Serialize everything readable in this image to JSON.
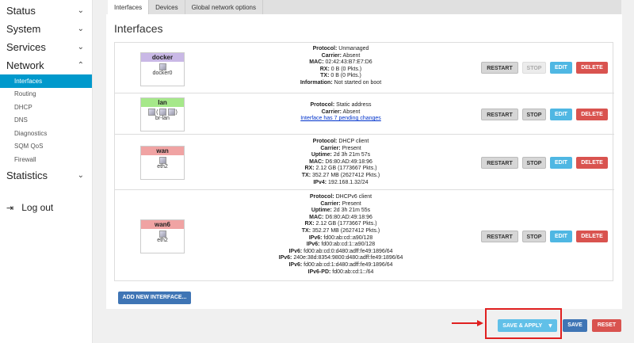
{
  "sidebar": {
    "status": "Status",
    "system": "System",
    "services": "Services",
    "network": "Network",
    "network_items": [
      "Interfaces",
      "Routing",
      "DHCP",
      "DNS",
      "Diagnostics",
      "SQM QoS",
      "Firewall"
    ],
    "statistics": "Statistics",
    "logout": "Log out"
  },
  "tabs": [
    "Interfaces",
    "Devices",
    "Global network options"
  ],
  "page_title": "Interfaces",
  "interfaces": [
    {
      "name": "docker",
      "color": "#c9b8e6",
      "device": "docker0",
      "info": [
        [
          "Protocol:",
          "Unmanaged"
        ],
        [
          "Carrier:",
          "Absent"
        ],
        [
          "MAC:",
          "02:42:43:B7:E7:D6"
        ],
        [
          "RX:",
          "0 B (0 Pkts.)"
        ],
        [
          "TX:",
          "0 B (0 Pkts.)"
        ],
        [
          "Information:",
          "Not started on boot"
        ]
      ],
      "stop_disabled": true
    },
    {
      "name": "lan",
      "color": "#a6e88a",
      "device": "br-lan",
      "info": [
        [
          "Protocol:",
          "Static address"
        ],
        [
          "Carrier:",
          "Absent"
        ]
      ],
      "link": "Interface has 7 pending changes",
      "stop_disabled": false
    },
    {
      "name": "wan",
      "color": "#f0a3a3",
      "device": "eth2",
      "info": [
        [
          "Protocol:",
          "DHCP client"
        ],
        [
          "Carrier:",
          "Present"
        ],
        [
          "Uptime:",
          "2d 3h 21m 57s"
        ],
        [
          "MAC:",
          "D6:80:AD:49:18:96"
        ],
        [
          "RX:",
          "2.12 GB (1773667 Pkts.)"
        ],
        [
          "TX:",
          "352.27 MB (2627412 Pkts.)"
        ],
        [
          "IPv4:",
          "192.168.1.32/24"
        ]
      ],
      "stop_disabled": false
    },
    {
      "name": "wan6",
      "color": "#f0a3a3",
      "device": "eth2",
      "info": [
        [
          "Protocol:",
          "DHCPv6 client"
        ],
        [
          "Carrier:",
          "Present"
        ],
        [
          "Uptime:",
          "2d 3h 21m 55s"
        ],
        [
          "MAC:",
          "D6:80:AD:49:18:96"
        ],
        [
          "RX:",
          "2.12 GB (1773667 Pkts.)"
        ],
        [
          "TX:",
          "352.27 MB (2627412 Pkts.)"
        ],
        [
          "IPv6:",
          "fd00:ab:cd::a90/128"
        ],
        [
          "IPv6:",
          "fd00:ab:cd:1::a90/128"
        ],
        [
          "IPv6:",
          "fd00:ab:cd:0:d480:adff:fe49:1896/64"
        ],
        [
          "IPv6:",
          "240e:38d:8354:9800:d480:adff:fe49:1896/64"
        ],
        [
          "IPv6:",
          "fd00:ab:cd:1:d480:adff:fe49:1896/64"
        ],
        [
          "IPv6-PD:",
          "fd00:ab:cd:1::/64"
        ]
      ],
      "stop_disabled": false
    }
  ],
  "buttons": {
    "restart": "RESTART",
    "stop": "STOP",
    "edit": "EDIT",
    "delete": "DELETE"
  },
  "add_interface": "ADD NEW INTERFACE...",
  "footer": {
    "save_apply": "SAVE & APPLY",
    "save": "SAVE",
    "reset": "RESET"
  }
}
